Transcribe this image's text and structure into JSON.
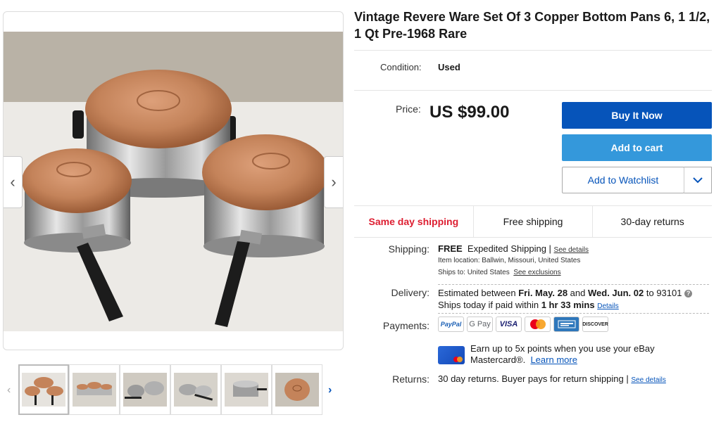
{
  "listing": {
    "title": "Vintage Revere Ware Set Of 3 Copper Bottom Pans 6, 1 1/2, 1 Qt Pre-1968 Rare",
    "condition_label": "Condition:",
    "condition_value": "Used",
    "price_label": "Price:",
    "price_value": "US $99.00"
  },
  "actions": {
    "buy_now": "Buy It Now",
    "add_to_cart": "Add to cart",
    "add_to_watchlist": "Add to Watchlist"
  },
  "features": [
    "Same day shipping",
    "Free shipping",
    "30-day returns"
  ],
  "shipping": {
    "label": "Shipping:",
    "free": "FREE",
    "method": "Expedited Shipping",
    "separator": " | ",
    "see_details": "See details",
    "item_location_label": "Item location:",
    "item_location": "Ballwin, Missouri, United States",
    "ships_to_label": "Ships to:",
    "ships_to": "United States",
    "see_exclusions": "See exclusions"
  },
  "delivery": {
    "label": "Delivery:",
    "estimated": "Estimated between",
    "date_from": "Fri. May. 28",
    "and": "and",
    "date_to": "Wed. Jun. 02",
    "to": "to 93101",
    "ships_today": "Ships today if paid within",
    "time_left": "1 hr 33 mins",
    "details": "Details"
  },
  "payments": {
    "label": "Payments:",
    "methods": [
      "PayPal",
      "G Pay",
      "VISA",
      "Mastercard",
      "Amex",
      "DISCOVER"
    ],
    "promo_line1": "Earn up to 5x points when you use your eBay",
    "promo_line2": "Mastercard®.",
    "learn_more": "Learn more"
  },
  "returns": {
    "label": "Returns:",
    "text": "30 day returns. Buyer pays for return shipping",
    "separator": " | ",
    "see_details": "See details"
  },
  "colors": {
    "primary_blue": "#0654ba",
    "light_blue": "#3498db",
    "feature_red": "#dd1e31",
    "copper": "#c4835a"
  },
  "icons": {
    "gallery_prev": "‹",
    "gallery_next": "›",
    "thumbs_prev": "‹",
    "thumbs_next": "›",
    "watch_caret": "⌄",
    "info": "?"
  }
}
